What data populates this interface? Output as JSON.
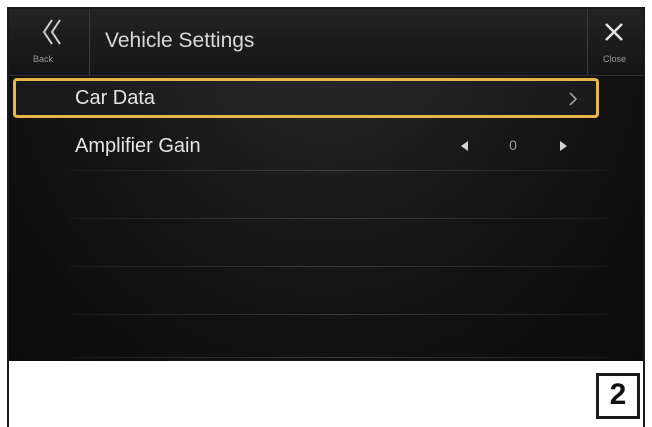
{
  "header": {
    "back_label": "Back",
    "title": "Vehicle Settings",
    "close_label": "Close"
  },
  "rows": [
    {
      "label": "Car Data",
      "selected": true,
      "icon": "chevron-right-icon"
    },
    {
      "label": "Amplifier Gain",
      "value": "0",
      "icons": [
        "arrow-left-icon",
        "arrow-right-icon"
      ]
    }
  ],
  "page_number": "2",
  "colors": {
    "selection_border": "#e6b64a",
    "background": "#141414",
    "text": "#e4e4e4"
  }
}
